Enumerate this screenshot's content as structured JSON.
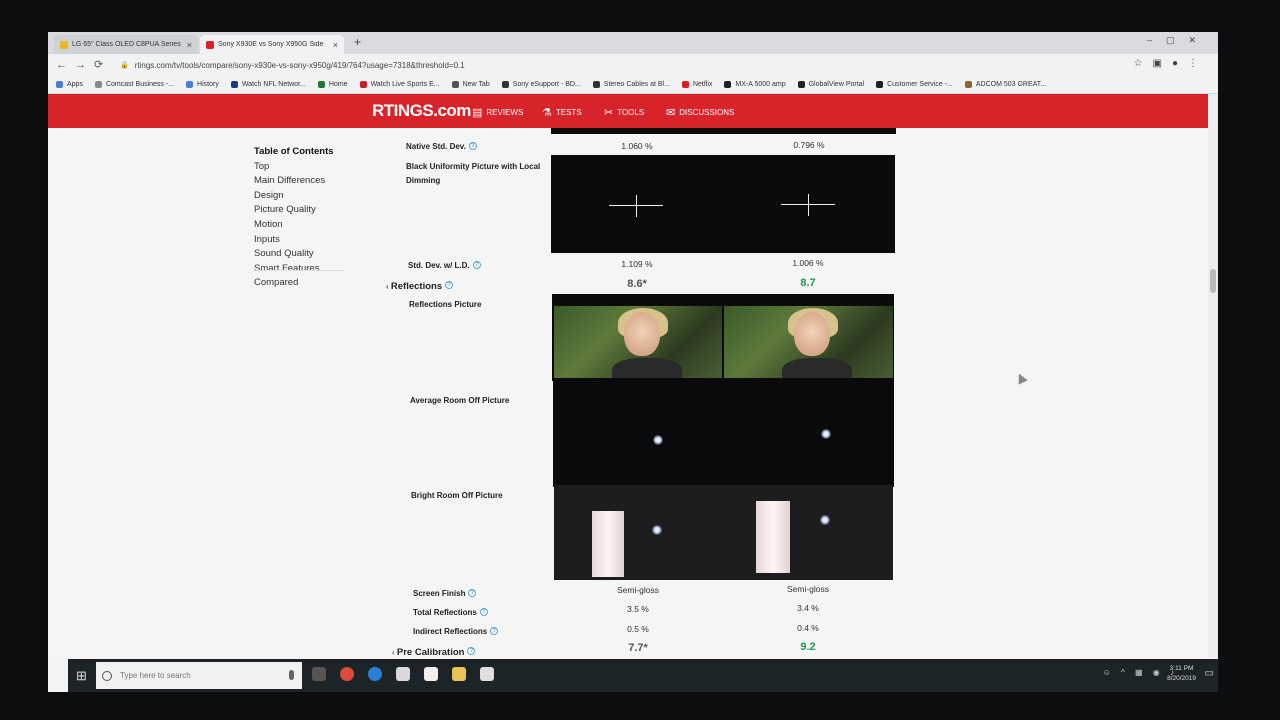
{
  "browser": {
    "tabs": [
      {
        "title": "LG 65\" Class OLED C8PUA Series",
        "color": "#e8b820"
      },
      {
        "title": "Sony X930E vs Sony X950G Side",
        "color": "#d8232a"
      }
    ],
    "url": "rtings.com/tv/tools/compare/sony-x930e-vs-sony-x950g/419/764?usage=7318&threshold=0.1",
    "bookmarks": [
      {
        "label": "Apps",
        "color": "#4a7fd4"
      },
      {
        "label": "Comcast Business -...",
        "color": "#8a8a8a"
      },
      {
        "label": "History",
        "color": "#4a7fd4"
      },
      {
        "label": "Watch NFL Networ...",
        "color": "#1a3d7a"
      },
      {
        "label": "Home",
        "color": "#1e7a3a"
      },
      {
        "label": "Watch Live Sports E...",
        "color": "#c8202a"
      },
      {
        "label": "New Tab",
        "color": "#555"
      },
      {
        "label": "Sony eSupport - BD...",
        "color": "#333"
      },
      {
        "label": "Stereo Cables at Bl...",
        "color": "#333"
      },
      {
        "label": "Netflix",
        "color": "#d81f26"
      },
      {
        "label": "MX-A 5000 amp",
        "color": "#222"
      },
      {
        "label": "GlobalView Portal",
        "color": "#222"
      },
      {
        "label": "Customer Service -...",
        "color": "#222"
      },
      {
        "label": "ADCOM 503 GREAT...",
        "color": "#8a6a2a"
      }
    ]
  },
  "site": {
    "logo": "RTINGS.com",
    "nav": [
      "REVIEWS",
      "TESTS",
      "TOOLS",
      "DISCUSSIONS"
    ]
  },
  "toc": {
    "heading": "Table of Contents",
    "items": [
      "Top",
      "Main Differences",
      "Design",
      "Picture Quality",
      "Motion",
      "Inputs",
      "Sound Quality",
      "Smart Features",
      "Compared"
    ]
  },
  "compare": {
    "native_std_dev": {
      "label": "Native Std. Dev.",
      "a": "1.060 %",
      "b": "0.796 %"
    },
    "black_uniformity": {
      "label": "Black Uniformity Picture with Local Dimming"
    },
    "std_dev_ld": {
      "label": "Std. Dev. w/ L.D.",
      "a": "1.109 %",
      "b": "1.006 %"
    },
    "reflections": {
      "label": "Reflections",
      "a": "8.6*",
      "b": "8.7"
    },
    "reflections_picture": {
      "label": "Reflections Picture"
    },
    "avg_room_off": {
      "label": "Average Room Off Picture"
    },
    "bright_room_off": {
      "label": "Bright Room Off Picture"
    },
    "screen_finish": {
      "label": "Screen Finish",
      "a": "Semi-gloss",
      "b": "Semi-gloss"
    },
    "total_reflections": {
      "label": "Total Reflections",
      "a": "3.5 %",
      "b": "3.4 %"
    },
    "indirect_reflections": {
      "label": "Indirect Reflections",
      "a": "0.5 %",
      "b": "0.4 %"
    },
    "pre_calibration": {
      "label": "Pre Calibration",
      "a": "7.7*",
      "b": "9.2"
    }
  },
  "colors": {
    "winner": "#1f9a4e",
    "loser": "#555555",
    "brand": "#d8232a"
  },
  "taskbar": {
    "search_placeholder": "Type here to search",
    "time": "3:11 PM",
    "date": "8/20/2019"
  }
}
